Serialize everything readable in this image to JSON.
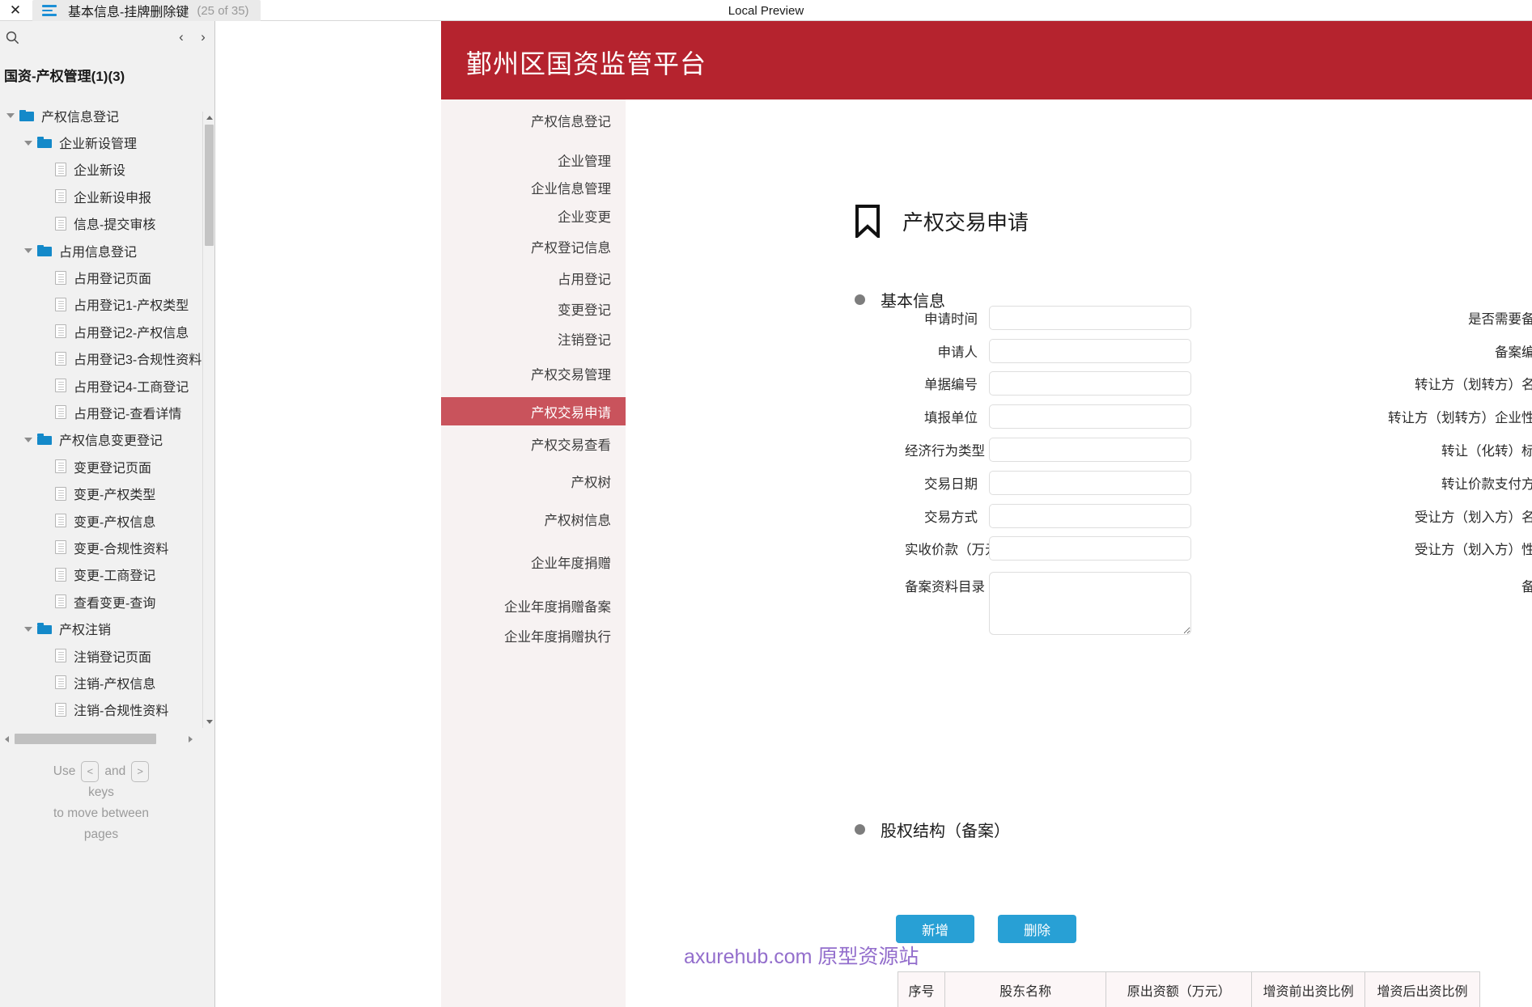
{
  "topbar": {
    "close_label": "✕",
    "tab_title": "基本信息-挂牌删除键",
    "tab_count": "(25 of 35)",
    "center_label": "Local Preview"
  },
  "left_panel": {
    "prev_label": "‹",
    "next_label": "›",
    "heading": "国资-产权管理(1)(3)",
    "tree": [
      {
        "label": "产权信息登记",
        "type": "folder",
        "indent": 0
      },
      {
        "label": "企业新设管理",
        "type": "folder",
        "indent": 1
      },
      {
        "label": "企业新设",
        "type": "page",
        "indent": 2
      },
      {
        "label": "企业新设申报",
        "type": "page",
        "indent": 2
      },
      {
        "label": "信息-提交审核",
        "type": "page",
        "indent": 2
      },
      {
        "label": "占用信息登记",
        "type": "folder",
        "indent": 1
      },
      {
        "label": "占用登记页面",
        "type": "page",
        "indent": 2
      },
      {
        "label": "占用登记1-产权类型",
        "type": "page",
        "indent": 2
      },
      {
        "label": "占用登记2-产权信息",
        "type": "page",
        "indent": 2
      },
      {
        "label": "占用登记3-合规性资料",
        "type": "page",
        "indent": 2
      },
      {
        "label": "占用登记4-工商登记",
        "type": "page",
        "indent": 2
      },
      {
        "label": "占用登记-查看详情",
        "type": "page",
        "indent": 2
      },
      {
        "label": "产权信息变更登记",
        "type": "folder",
        "indent": 1
      },
      {
        "label": "变更登记页面",
        "type": "page",
        "indent": 2
      },
      {
        "label": "变更-产权类型",
        "type": "page",
        "indent": 2
      },
      {
        "label": "变更-产权信息",
        "type": "page",
        "indent": 2
      },
      {
        "label": "变更-合规性资料",
        "type": "page",
        "indent": 2
      },
      {
        "label": "变更-工商登记",
        "type": "page",
        "indent": 2
      },
      {
        "label": "查看变更-查询",
        "type": "page",
        "indent": 2
      },
      {
        "label": "产权注销",
        "type": "folder",
        "indent": 1
      },
      {
        "label": "注销登记页面",
        "type": "page",
        "indent": 2
      },
      {
        "label": "注销-产权信息",
        "type": "page",
        "indent": 2
      },
      {
        "label": "注销-合规性资料",
        "type": "page",
        "indent": 2
      }
    ],
    "hint": {
      "use": "Use",
      "key_prev": "<",
      "and": "and",
      "key_next": ">",
      "line2": "keys",
      "line3": "to move between",
      "line4": "pages"
    }
  },
  "app": {
    "brand": "鄞州区国资监管平台",
    "brand_color": "#b5232e",
    "selected_color": "#c9535c",
    "sidenav": [
      {
        "label": "产权信息登记",
        "level": 1,
        "selected": false
      },
      {
        "label": "企业管理",
        "level": 1,
        "selected": false
      },
      {
        "label": "企业信息管理",
        "level": 2,
        "selected": false
      },
      {
        "label": "企业变更",
        "level": 2,
        "selected": false
      },
      {
        "label": "产权登记信息",
        "level": 1,
        "selected": false
      },
      {
        "label": "占用登记",
        "level": 2,
        "selected": false
      },
      {
        "label": "变更登记",
        "level": 2,
        "selected": false
      },
      {
        "label": "注销登记",
        "level": 2,
        "selected": false
      },
      {
        "label": "产权交易管理",
        "level": 1,
        "selected": false
      },
      {
        "label": "产权交易申请",
        "level": 2,
        "selected": true
      },
      {
        "label": "产权交易查看",
        "level": 2,
        "selected": false
      },
      {
        "label": "产权树",
        "level": 1,
        "selected": false
      },
      {
        "label": "产权树信息",
        "level": 2,
        "selected": false
      },
      {
        "label": "企业年度捐赠",
        "level": 1,
        "selected": false
      },
      {
        "label": "企业年度捐赠备案",
        "level": 2,
        "selected": false
      },
      {
        "label": "企业年度捐赠执行",
        "level": 2,
        "selected": false
      }
    ],
    "page_title": "产权交易申请",
    "section_basic": "基本信息",
    "section_equity": "股权结构（备案）",
    "form_left": [
      {
        "label": "申请时间",
        "value": ""
      },
      {
        "label": "申请人",
        "value": ""
      },
      {
        "label": "单据编号",
        "value": ""
      },
      {
        "label": "填报单位",
        "value": ""
      },
      {
        "label": "经济行为类型",
        "value": ""
      },
      {
        "label": "交易日期",
        "value": ""
      },
      {
        "label": "交易方式",
        "value": ""
      },
      {
        "label": "实收价款（万元）",
        "value": ""
      },
      {
        "label": "备案资料目录",
        "value": ""
      }
    ],
    "form_right": [
      {
        "label": "是否需要备案",
        "value": ""
      },
      {
        "label": "备案编号",
        "value": ""
      },
      {
        "label": "转让方（划转方）名称",
        "value": ""
      },
      {
        "label": "转让方（划转方）企业性质",
        "value": ""
      },
      {
        "label": "转让（化转）标的",
        "value": ""
      },
      {
        "label": "转让价款支付方式",
        "value": ""
      },
      {
        "label": "受让方（划入方）名称",
        "value": ""
      },
      {
        "label": "受让方（划入方）性质",
        "value": ""
      },
      {
        "label": "备注",
        "value": ""
      }
    ],
    "buttons": {
      "add": "新增",
      "delete": "删除"
    },
    "table_headers": [
      "序号",
      "股东名称",
      "原出资额（万元）",
      "增资前出资比例",
      "增资后出资比例"
    ],
    "watermark_en": "axurehub.com",
    "watermark_cn": "原型资源站"
  }
}
